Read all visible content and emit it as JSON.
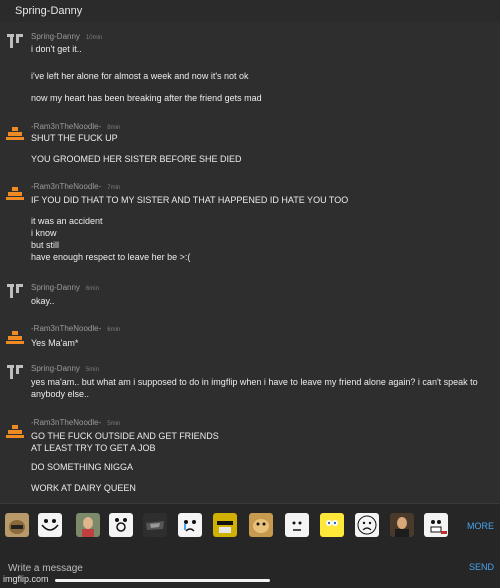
{
  "header": {
    "title": "Spring-Danny"
  },
  "users": {
    "danny": {
      "name": "Spring-Danny",
      "icon": "spring-logo-icon",
      "color": "#bfbfbf"
    },
    "ram": {
      "name": "-Ram3nTheNoodle-",
      "icon": "noodle-pyramid-icon",
      "color": "#f08a24"
    }
  },
  "messages": [
    {
      "author": "Spring-Danny",
      "time": "10min",
      "lines": [
        "i don't get it..",
        "i've left her alone for almost a week and now it's not ok",
        "now my heart has been breaking after the friend gets mad"
      ]
    },
    {
      "author": "-Ram3nTheNoodle-",
      "time": "8min",
      "lines": [
        "SHUT THE FUCK UP",
        "YOU GROOMED HER SISTER BEFORE SHE DIED"
      ]
    },
    {
      "author": "-Ram3nTheNoodle-",
      "time": "7min",
      "lines": [
        "IF YOU DID THAT TO MY SISTER AND THAT HAPPENED ID HATE YOU TOO",
        "it was an accident",
        "i know",
        "but still",
        "have enough respect to leave her be >:("
      ]
    },
    {
      "author": "Spring-Danny",
      "time": "6min",
      "lines": [
        "okay.."
      ]
    },
    {
      "author": "-Ram3nTheNoodle-",
      "time": "6min",
      "lines": [
        "Yes Ma'am*"
      ]
    },
    {
      "author": "Spring-Danny",
      "time": "5min",
      "lines": [
        "yes ma'am.. but what am i supposed to do in imgflip when i have to leave my friend alone again? i can't speak to anybody else.."
      ]
    },
    {
      "author": "-Ram3nTheNoodle-",
      "time": "5min",
      "lines": [
        "GO THE FUCK OUTSIDE AND GET FRIENDS",
        "AT LEAST TRY TO GET A JOB",
        "DO SOMETHING NIGGA",
        "WORK AT DAIRY QUEEN"
      ]
    }
  ],
  "emoji_bar": {
    "items": [
      "cat-meme-icon",
      "troll-face-icon",
      "woman-photo-icon",
      "shocked-face-icon",
      "dark-meme-icon",
      "crying-face-icon",
      "deal-with-it-icon",
      "doge-icon",
      "okay-face-icon",
      "spongebob-icon",
      "sad-face-icon",
      "leonardo-toast-icon",
      "fuu-face-icon"
    ],
    "more_label": "MORE"
  },
  "compose": {
    "placeholder": "Write a message",
    "value": "",
    "send_label": "SEND"
  },
  "watermark": "imgflip.com",
  "colors": {
    "background": "#2e2e2e",
    "accent": "#4aa3f0",
    "ram_orange": "#f08a24"
  }
}
